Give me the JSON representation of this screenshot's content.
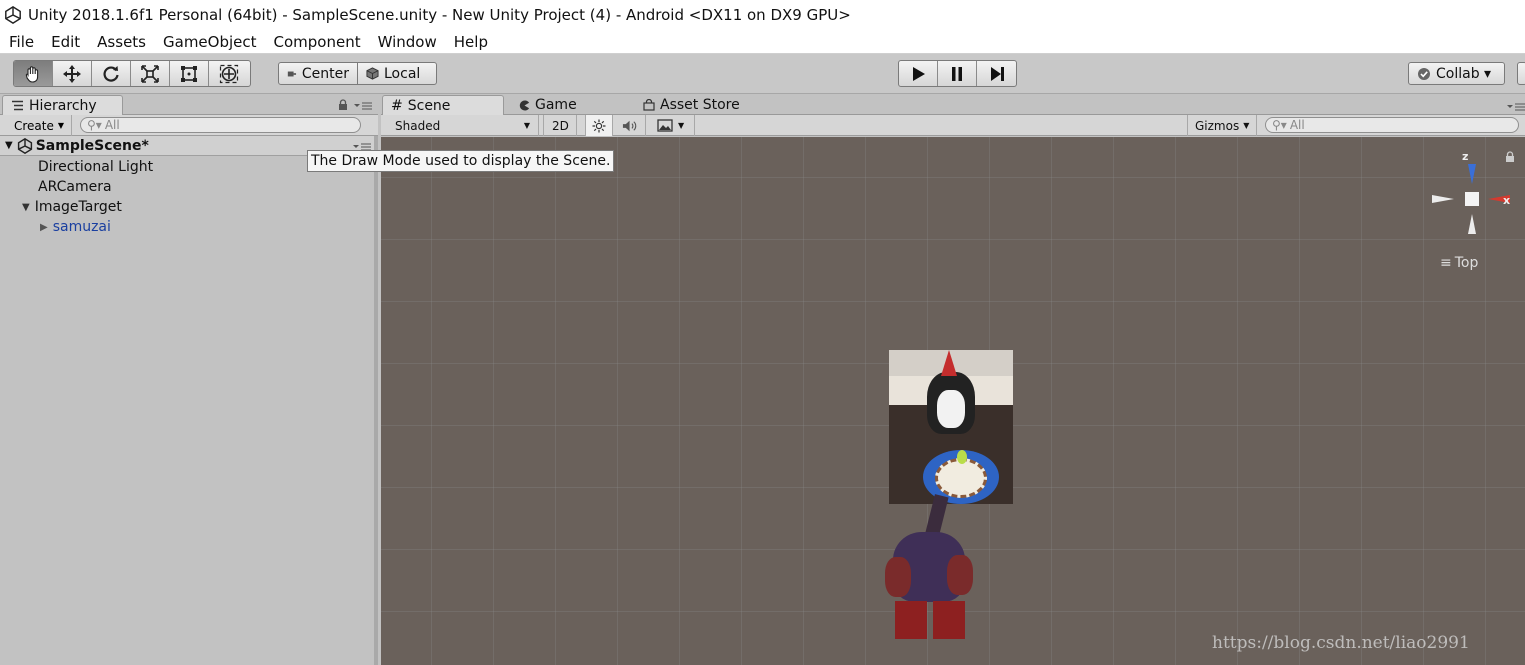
{
  "window": {
    "title": "Unity 2018.1.6f1 Personal (64bit) - SampleScene.unity - New Unity Project (4) - Android <DX11 on DX9 GPU>"
  },
  "menu": [
    "File",
    "Edit",
    "Assets",
    "GameObject",
    "Component",
    "Window",
    "Help"
  ],
  "toolbar": {
    "tools": [
      "hand-tool-icon",
      "move-tool-icon",
      "rotate-tool-icon",
      "scale-tool-icon",
      "rect-tool-icon",
      "transform-tool-icon"
    ],
    "pivot_label": "Center",
    "space_label": "Local",
    "collab_label": "Collab ▾"
  },
  "hierarchy": {
    "tab_label": "Hierarchy",
    "create_label": "Create",
    "search_placeholder": "All",
    "scene_name": "SampleScene*",
    "items": [
      "Directional Light",
      "ARCamera",
      "ImageTarget",
      "samuzai"
    ]
  },
  "tabs": {
    "scene": "Scene",
    "game": "Game",
    "asset_store": "Asset Store"
  },
  "scene_toolbar": {
    "draw_mode": "Shaded",
    "mode_2d": "2D",
    "gizmos_label": "Gizmos",
    "search_placeholder": "All"
  },
  "tooltip": "The Draw Mode used to display the Scene.",
  "gizmo": {
    "z_label": "z",
    "x_label": "x",
    "view_label": "Top"
  },
  "watermark": "https://blog.csdn.net/liao2991",
  "colors": {
    "viewport_bg": "#6a615b",
    "selected_child": "#1a3fa0",
    "panel_bg": "#c2c2c2"
  }
}
